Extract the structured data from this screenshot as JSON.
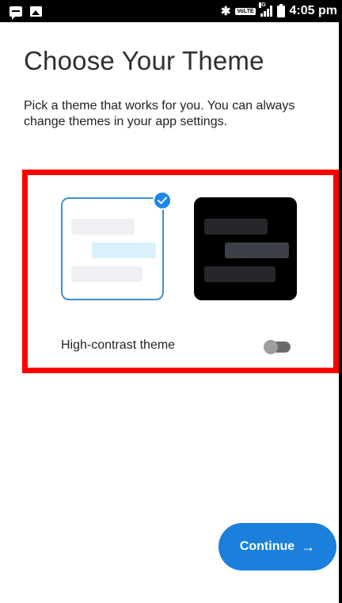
{
  "status_bar": {
    "time": "4:05 pm",
    "network_label": "VoLTE",
    "lte_label": "4G",
    "icons": [
      "message-icon",
      "image-icon",
      "bluetooth-icon",
      "signal-icon",
      "battery-icon"
    ]
  },
  "page": {
    "title": "Choose Your Theme",
    "subtitle": "Pick a theme that works for you. You can always change themes in your app settings."
  },
  "themes": {
    "options": [
      {
        "name": "light",
        "selected": true
      },
      {
        "name": "dark",
        "selected": false
      }
    ],
    "high_contrast_label": "High-contrast theme",
    "high_contrast_enabled": false
  },
  "actions": {
    "continue_label": "Continue",
    "continue_arrow": "→"
  },
  "colors": {
    "accent": "#1a80dc",
    "highlight_border": "#ff0000",
    "selected_border": "#3d8fd6"
  }
}
